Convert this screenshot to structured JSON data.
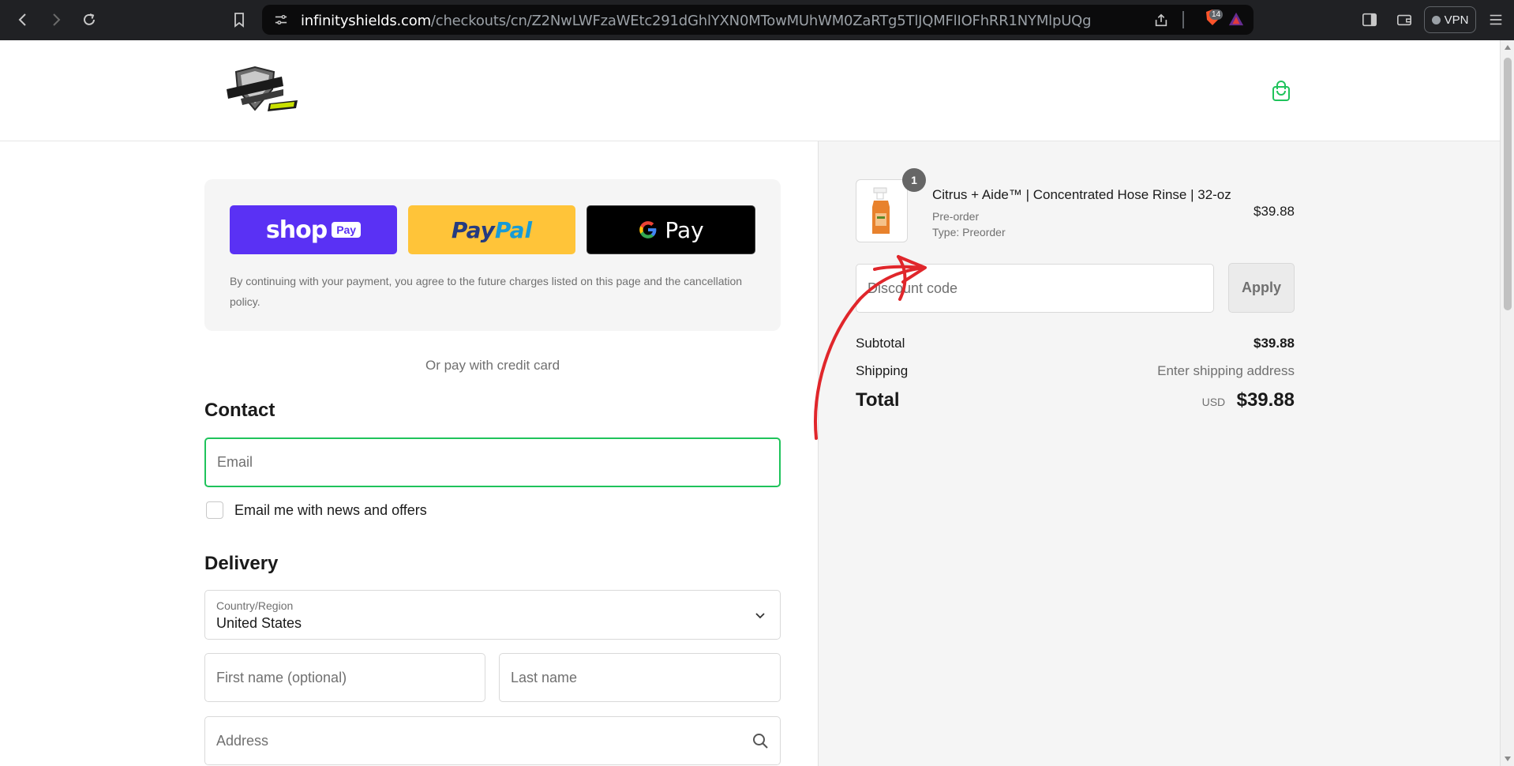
{
  "browser": {
    "url_host": "infinityshields.com",
    "url_path": "/checkouts/cn/Z2NwLWFzaWEtc291dGhlYXN0MTowMUhWM0ZaRTg5TlJQMFlIOFhRR1NYMlpUQg",
    "shield_count": "14",
    "vpn_label": "VPN"
  },
  "express": {
    "shop_pay_word": "shop",
    "shop_pay_pill": "Pay",
    "paypal_part1": "Pay",
    "paypal_part2": "Pal",
    "gpay_word": "Pay",
    "consent_text": "By continuing with your payment, you agree to the future charges listed on this page and the cancellation policy."
  },
  "or_pay_text": "Or pay with credit card",
  "contact": {
    "heading": "Contact",
    "email_placeholder": "Email",
    "newsletter_label": "Email me with news and offers"
  },
  "delivery": {
    "heading": "Delivery",
    "country_label": "Country/Region",
    "country_value": "United States",
    "first_name_placeholder": "First name (optional)",
    "last_name_placeholder": "Last name",
    "address_placeholder": "Address"
  },
  "order": {
    "quantity": "1",
    "product_title": "Citrus + Aide™ | Concentrated Hose Rinse | 32-oz",
    "product_subtitle": "Pre-order",
    "product_type": "Type: Preorder",
    "product_price": "$39.88",
    "discount_placeholder": "Discount code",
    "apply_label": "Apply",
    "subtotal_label": "Subtotal",
    "subtotal_value": "$39.88",
    "shipping_label": "Shipping",
    "shipping_value": "Enter shipping address",
    "total_label": "Total",
    "total_currency": "USD",
    "total_value": "$39.88"
  },
  "colors": {
    "accent_green": "#1fc35b",
    "shop_pay": "#5a31f4",
    "paypal": "#ffc439",
    "annotation_red": "#e0262b"
  }
}
